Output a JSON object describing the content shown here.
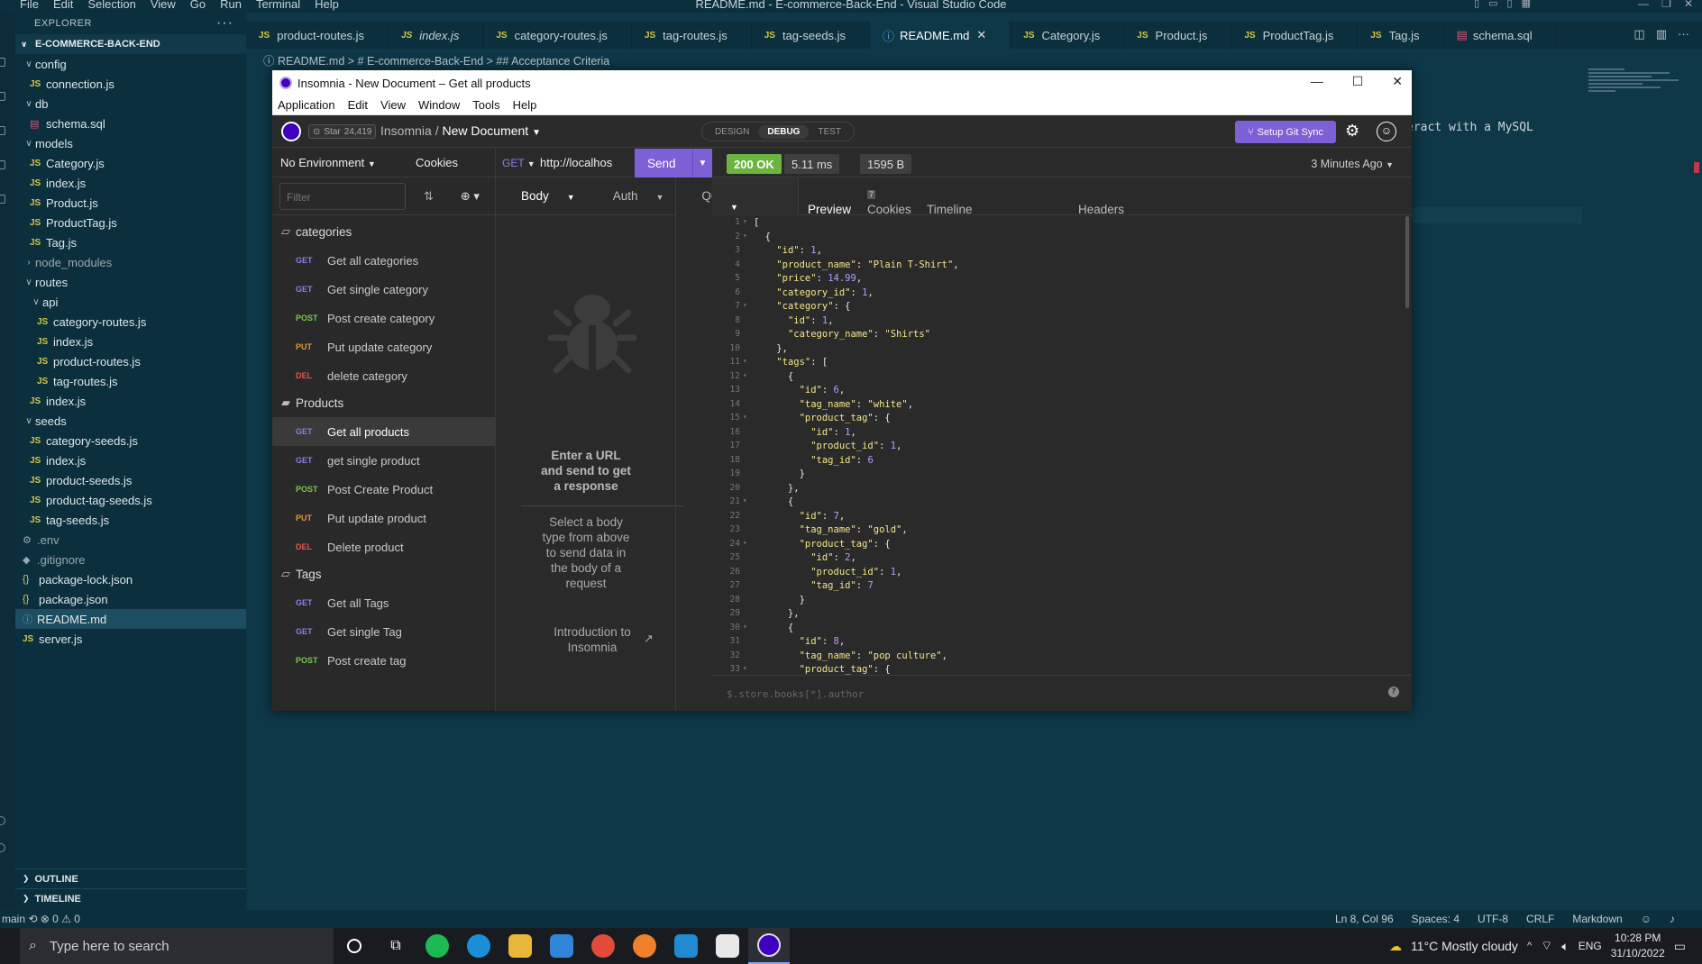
{
  "vscode": {
    "menu": [
      "File",
      "Edit",
      "Selection",
      "View",
      "Go",
      "Run",
      "Terminal",
      "Help"
    ],
    "title": "README.md - E-commerce-Back-End - Visual Studio Code",
    "explorer_label": "EXPLORER",
    "project": "E-COMMERCE-BACK-END",
    "tree": [
      {
        "label": "config",
        "kind": "folder",
        "depth": 0
      },
      {
        "label": "connection.js",
        "kind": "js",
        "depth": 1
      },
      {
        "label": "db",
        "kind": "folder",
        "depth": 0
      },
      {
        "label": "schema.sql",
        "kind": "db",
        "depth": 1
      },
      {
        "label": "models",
        "kind": "folder",
        "depth": 0
      },
      {
        "label": "Category.js",
        "kind": "js",
        "depth": 1
      },
      {
        "label": "index.js",
        "kind": "js",
        "depth": 1
      },
      {
        "label": "Product.js",
        "kind": "js",
        "depth": 1
      },
      {
        "label": "ProductTag.js",
        "kind": "js",
        "depth": 1
      },
      {
        "label": "Tag.js",
        "kind": "js",
        "depth": 1
      },
      {
        "label": "node_modules",
        "kind": "folder-closed",
        "depth": 0
      },
      {
        "label": "routes",
        "kind": "folder",
        "depth": 0
      },
      {
        "label": "api",
        "kind": "folder",
        "depth": 1
      },
      {
        "label": "category-routes.js",
        "kind": "js",
        "depth": 2
      },
      {
        "label": "index.js",
        "kind": "js",
        "depth": 2
      },
      {
        "label": "product-routes.js",
        "kind": "js",
        "depth": 2
      },
      {
        "label": "tag-routes.js",
        "kind": "js",
        "depth": 2
      },
      {
        "label": "index.js",
        "kind": "js",
        "depth": 1
      },
      {
        "label": "seeds",
        "kind": "folder",
        "depth": 0
      },
      {
        "label": "category-seeds.js",
        "kind": "js",
        "depth": 1
      },
      {
        "label": "index.js",
        "kind": "js",
        "depth": 1
      },
      {
        "label": "product-seeds.js",
        "kind": "js",
        "depth": 1
      },
      {
        "label": "product-tag-seeds.js",
        "kind": "js",
        "depth": 1
      },
      {
        "label": "tag-seeds.js",
        "kind": "js",
        "depth": 1
      },
      {
        "label": ".env",
        "kind": "gear",
        "depth": 0
      },
      {
        "label": ".gitignore",
        "kind": "dot",
        "depth": 0
      },
      {
        "label": "package-lock.json",
        "kind": "json",
        "depth": 0
      },
      {
        "label": "package.json",
        "kind": "json",
        "depth": 0
      },
      {
        "label": "README.md",
        "kind": "info",
        "depth": 0,
        "selected": true
      },
      {
        "label": "server.js",
        "kind": "js",
        "depth": 0
      }
    ],
    "outline": "OUTLINE",
    "timeline": "TIMELINE",
    "tabs": [
      {
        "label": "product-routes.js",
        "kind": "js"
      },
      {
        "label": "index.js",
        "kind": "js",
        "italic": true
      },
      {
        "label": "category-routes.js",
        "kind": "js"
      },
      {
        "label": "tag-routes.js",
        "kind": "js"
      },
      {
        "label": "tag-seeds.js",
        "kind": "js"
      },
      {
        "label": "README.md",
        "kind": "info",
        "active": true
      },
      {
        "label": "Category.js",
        "kind": "js"
      },
      {
        "label": "Product.js",
        "kind": "js"
      },
      {
        "label": "ProductTag.js",
        "kind": "js"
      },
      {
        "label": "Tag.js",
        "kind": "js"
      },
      {
        "label": "schema.sql",
        "kind": "db"
      }
    ],
    "breadcrumb": "ⓘ README.md  >  # E-commerce-Back-End  >  ## Acceptance Criteria",
    "editor_fragment": "eract with a MySQL",
    "status_left": "main   ⟲   ⊗ 0 ⚠ 0",
    "status_right": [
      "Ln 8, Col 96",
      "Spaces: 4",
      "UTF-8",
      "CRLF",
      "Markdown"
    ]
  },
  "taskbar": {
    "search_placeholder": "Type here to search",
    "weather": "11°C  Mostly cloudy",
    "lang": "ENG",
    "time": "10:28 PM",
    "date": "31/10/2022"
  },
  "insomnia": {
    "window_title": "Insomnia - New Document – Get all products",
    "menu": [
      "Application",
      "Edit",
      "View",
      "Window",
      "Tools",
      "Help"
    ],
    "star_label": "Star",
    "star_count": "24,419",
    "crumb_root": "Insomnia",
    "crumb_doc": "New Document",
    "modes": [
      "DESIGN",
      "DEBUG",
      "TEST"
    ],
    "active_mode": "DEBUG",
    "git_sync": "Setup Git Sync",
    "environment": "No Environment",
    "cookies": "Cookies",
    "filter_placeholder": "Filter",
    "groups": [
      {
        "name": "categories",
        "requests": [
          {
            "method": "GET",
            "label": "Get all categories"
          },
          {
            "method": "GET",
            "label": "Get single category"
          },
          {
            "method": "POST",
            "label": "Post create category"
          },
          {
            "method": "PUT",
            "label": "Put update category"
          },
          {
            "method": "DEL",
            "label": "delete category"
          }
        ]
      },
      {
        "name": "Products",
        "open": true,
        "requests": [
          {
            "method": "GET",
            "label": "Get all products",
            "selected": true
          },
          {
            "method": "GET",
            "label": "get single product"
          },
          {
            "method": "POST",
            "label": "Post Create Product"
          },
          {
            "method": "PUT",
            "label": "Put update product"
          },
          {
            "method": "DEL",
            "label": "Delete product"
          }
        ]
      },
      {
        "name": "Tags",
        "requests": [
          {
            "method": "GET",
            "label": "Get all Tags"
          },
          {
            "method": "GET",
            "label": "Get single Tag"
          },
          {
            "method": "POST",
            "label": "Post create tag"
          }
        ]
      }
    ],
    "request": {
      "method": "GET",
      "url": "http://localhos",
      "send": "Send",
      "tabs": [
        "Body",
        "Auth",
        "Query"
      ],
      "empty_title": "Enter a URL and send to get a response",
      "empty_body": "Select a body type from above to send data in the body of a request",
      "intro": "Introduction to Insomnia"
    },
    "response": {
      "status": "200 OK",
      "time": "5.11 ms",
      "size": "1595 B",
      "ago": "3 Minutes Ago",
      "tabs": [
        "Preview",
        "Headers",
        "Cookies",
        "Timeline"
      ],
      "headers_count": "7",
      "filter_placeholder": "$.store.books[*].author",
      "lines": [
        "[",
        "  {",
        "    \"id\": 1,",
        "    \"product_name\": \"Plain T-Shirt\",",
        "    \"price\": 14.99,",
        "    \"category_id\": 1,",
        "    \"category\": {",
        "      \"id\": 1,",
        "      \"category_name\": \"Shirts\"",
        "    },",
        "    \"tags\": [",
        "      {",
        "        \"id\": 6,",
        "        \"tag_name\": \"white\",",
        "        \"product_tag\": {",
        "          \"id\": 1,",
        "          \"product_id\": 1,",
        "          \"tag_id\": 6",
        "        }",
        "      },",
        "      {",
        "        \"id\": 7,",
        "        \"tag_name\": \"gold\",",
        "        \"product_tag\": {",
        "          \"id\": 2,",
        "          \"product_id\": 1,",
        "          \"tag_id\": 7",
        "        }",
        "      },",
        "      {",
        "        \"id\": 8,",
        "        \"tag_name\": \"pop culture\",",
        "        \"product_tag\": {"
      ]
    }
  }
}
